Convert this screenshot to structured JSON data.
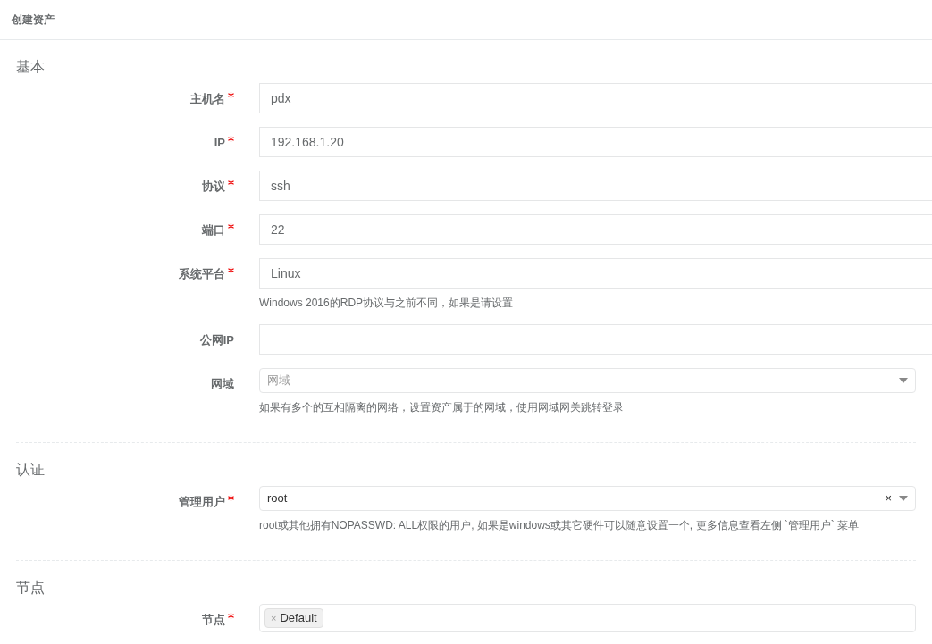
{
  "page_title": "创建资产",
  "sections": [
    {
      "title": "基本",
      "fields": [
        {
          "label": "主机名",
          "required": true,
          "kind": "input",
          "value": "pdx"
        },
        {
          "label": "IP",
          "required": true,
          "kind": "input",
          "value": "192.168.1.20"
        },
        {
          "label": "协议",
          "required": true,
          "kind": "input",
          "value": "ssh"
        },
        {
          "label": "端口",
          "required": true,
          "kind": "input",
          "value": "22"
        },
        {
          "label": "系统平台",
          "required": true,
          "kind": "input",
          "value": "Linux",
          "help": "Windows 2016的RDP协议与之前不同，如果是请设置"
        },
        {
          "label": "公网IP",
          "required": false,
          "kind": "input"
        },
        {
          "label": "网域",
          "required": false,
          "kind": "select",
          "placeholder": "网域",
          "help": "如果有多个的互相隔离的网络，设置资产属于的网域，使用网域网关跳转登录"
        }
      ]
    },
    {
      "title": "认证",
      "fields": [
        {
          "label": "管理用户",
          "required": true,
          "kind": "select",
          "value": "root",
          "clear": "×",
          "help": "root或其他拥有NOPASSWD: ALL权限的用户, 如果是windows或其它硬件可以随意设置一个, 更多信息查看左侧 `管理用户` 菜单"
        }
      ]
    },
    {
      "title": "节点",
      "fields": [
        {
          "label": "节点",
          "required": true,
          "kind": "tags",
          "tags": [
            {
              "remove": "×",
              "label": "Default"
            }
          ]
        }
      ]
    }
  ]
}
